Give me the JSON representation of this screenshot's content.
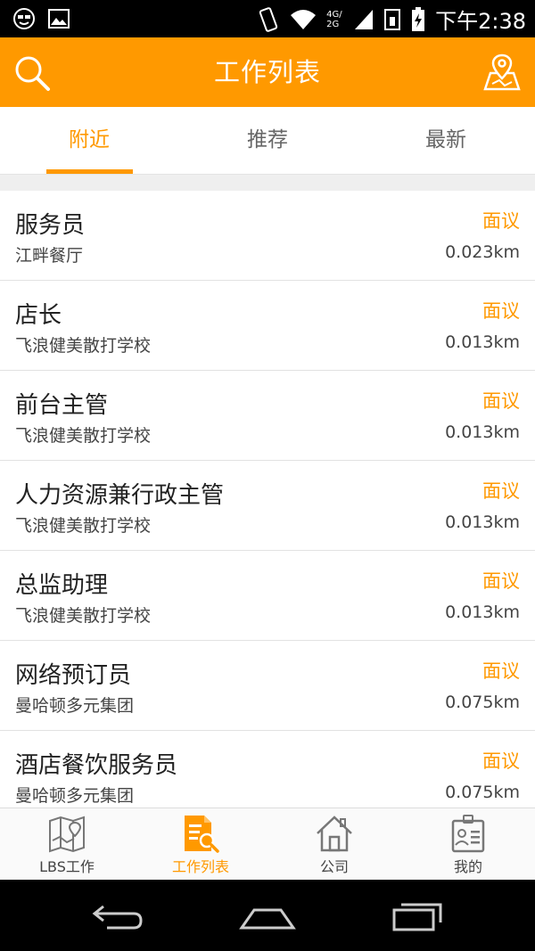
{
  "status_bar": {
    "time": "下午2:38",
    "network_label": "4G/2G"
  },
  "header": {
    "title": "工作列表",
    "search_icon": "search-icon",
    "map_icon": "map-location-icon"
  },
  "tabs": [
    {
      "label": "附近",
      "active": true
    },
    {
      "label": "推荐",
      "active": false
    },
    {
      "label": "最新",
      "active": false
    }
  ],
  "jobs": [
    {
      "title": "服务员",
      "company": "江畔餐厅",
      "salary": "面议",
      "distance": "0.023km"
    },
    {
      "title": "店长",
      "company": "飞浪健美散打学校",
      "salary": "面议",
      "distance": "0.013km"
    },
    {
      "title": "前台主管",
      "company": "飞浪健美散打学校",
      "salary": "面议",
      "distance": "0.013km"
    },
    {
      "title": "人力资源兼行政主管",
      "company": "飞浪健美散打学校",
      "salary": "面议",
      "distance": "0.013km"
    },
    {
      "title": "总监助理",
      "company": "飞浪健美散打学校",
      "salary": "面议",
      "distance": "0.013km"
    },
    {
      "title": "网络预订员",
      "company": "曼哈顿多元集团",
      "salary": "面议",
      "distance": "0.075km"
    },
    {
      "title": "酒店餐饮服务员",
      "company": "曼哈顿多元集团",
      "salary": "面议",
      "distance": "0.075km"
    }
  ],
  "bottom_nav": [
    {
      "label": "LBS工作",
      "icon": "map-icon",
      "active": false
    },
    {
      "label": "工作列表",
      "icon": "job-list-icon",
      "active": true
    },
    {
      "label": "公司",
      "icon": "house-icon",
      "active": false
    },
    {
      "label": "我的",
      "icon": "id-badge-icon",
      "active": false
    }
  ],
  "colors": {
    "accent": "#ff9900",
    "text": "#222222",
    "muted": "#444444"
  }
}
